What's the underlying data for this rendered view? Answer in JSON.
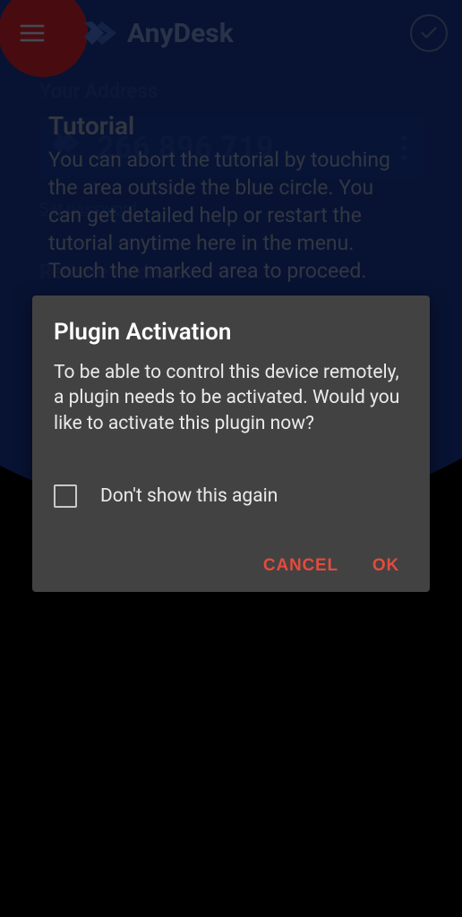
{
  "header": {
    "brand_name": "AnyDesk"
  },
  "background": {
    "your_address_label": "Your Address",
    "address_number": "266 896 719",
    "set_password_link": "Set password",
    "remote_address_label": "Remote Address"
  },
  "tutorial": {
    "title": "Tutorial",
    "body": "You can abort the tutorial by touching the area outside the blue circle. You can get detailed help or restart the tutorial anytime here in the menu. Touch the marked area to proceed."
  },
  "dialog": {
    "title": "Plugin Activation",
    "body": "To be able to control this device remotely, a plugin needs to be activated. Would you like to activate this plugin now?",
    "dont_show_label": "Don't show this again",
    "cancel_label": "CANCEL",
    "ok_label": "OK"
  }
}
